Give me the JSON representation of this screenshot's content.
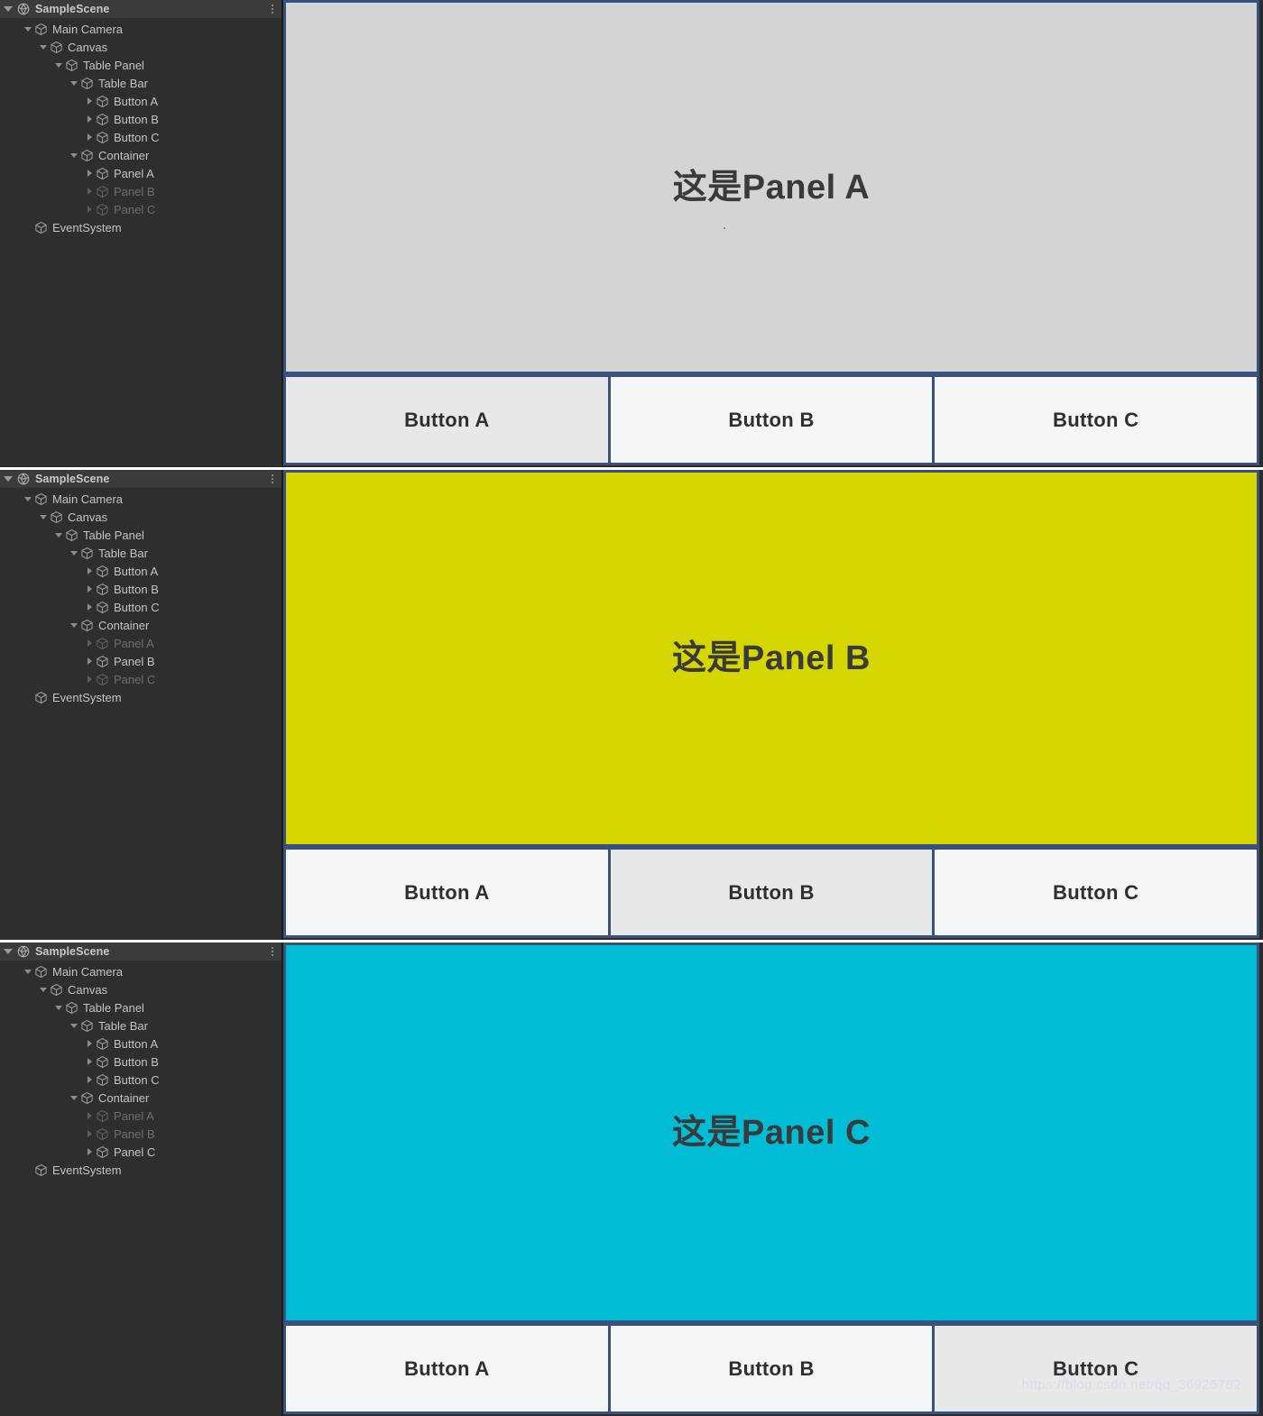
{
  "app": {
    "editor": "Unity Editor",
    "watermark": "https://blog.csdn.net/qq_36926782"
  },
  "colors": {
    "panel_a": "#d4d4d4",
    "panel_b": "#d6d600",
    "panel_c": "#00bcd4",
    "panel_border": "#3a5180",
    "tab_idle": "#f6f6f6",
    "tab_active": "#e8e8e8",
    "hierarchy_bg": "#2e2e2e",
    "hierarchy_header_bg": "#3b3b3b",
    "text_normal": "#c4c4c4",
    "text_dim": "#6e6e6e"
  },
  "sections": [
    {
      "hierarchy": {
        "scene_name": "SampleScene",
        "scene_icon": "unity-scene-icon",
        "menu_icon": "kebab-menu-icon",
        "collapse_icon": "triangle-down-icon",
        "nodes": [
          {
            "label": "Main Camera",
            "indent": 1,
            "arrow": "down",
            "dim": false
          },
          {
            "label": "Canvas",
            "indent": 2,
            "arrow": "down",
            "dim": false
          },
          {
            "label": "Table Panel",
            "indent": 3,
            "arrow": "down",
            "dim": false
          },
          {
            "label": "Table Bar",
            "indent": 4,
            "arrow": "down",
            "dim": false
          },
          {
            "label": "Button A",
            "indent": 5,
            "arrow": "right",
            "dim": false
          },
          {
            "label": "Button B",
            "indent": 5,
            "arrow": "right",
            "dim": false
          },
          {
            "label": "Button C",
            "indent": 5,
            "arrow": "right",
            "dim": false
          },
          {
            "label": "Container",
            "indent": 4,
            "arrow": "down",
            "dim": false
          },
          {
            "label": "Panel A",
            "indent": 5,
            "arrow": "right",
            "dim": false
          },
          {
            "label": "Panel B",
            "indent": 5,
            "arrow": "right",
            "dim": true
          },
          {
            "label": "Panel C",
            "indent": 5,
            "arrow": "right",
            "dim": true
          },
          {
            "label": "EventSystem",
            "indent": 1,
            "arrow": "none",
            "dim": false
          }
        ]
      },
      "game": {
        "panel_text": "这是Panel A",
        "panel_color": "#d4d4d4",
        "show_dot": true,
        "tabs": [
          {
            "label": "Button A",
            "active": true
          },
          {
            "label": "Button B",
            "active": false
          },
          {
            "label": "Button C",
            "active": false
          }
        ]
      }
    },
    {
      "hierarchy": {
        "scene_name": "SampleScene",
        "scene_icon": "unity-scene-icon",
        "menu_icon": "kebab-menu-icon",
        "collapse_icon": "triangle-down-icon",
        "nodes": [
          {
            "label": "Main Camera",
            "indent": 1,
            "arrow": "down",
            "dim": false
          },
          {
            "label": "Canvas",
            "indent": 2,
            "arrow": "down",
            "dim": false
          },
          {
            "label": "Table Panel",
            "indent": 3,
            "arrow": "down",
            "dim": false
          },
          {
            "label": "Table Bar",
            "indent": 4,
            "arrow": "down",
            "dim": false
          },
          {
            "label": "Button A",
            "indent": 5,
            "arrow": "right",
            "dim": false
          },
          {
            "label": "Button B",
            "indent": 5,
            "arrow": "right",
            "dim": false
          },
          {
            "label": "Button C",
            "indent": 5,
            "arrow": "right",
            "dim": false
          },
          {
            "label": "Container",
            "indent": 4,
            "arrow": "down",
            "dim": false
          },
          {
            "label": "Panel A",
            "indent": 5,
            "arrow": "right",
            "dim": true
          },
          {
            "label": "Panel B",
            "indent": 5,
            "arrow": "right",
            "dim": false
          },
          {
            "label": "Panel C",
            "indent": 5,
            "arrow": "right",
            "dim": true
          },
          {
            "label": "EventSystem",
            "indent": 1,
            "arrow": "none",
            "dim": false
          }
        ]
      },
      "game": {
        "panel_text": "这是Panel B",
        "panel_color": "#d6d600",
        "show_dot": false,
        "tabs": [
          {
            "label": "Button A",
            "active": false
          },
          {
            "label": "Button B",
            "active": true
          },
          {
            "label": "Button C",
            "active": false
          }
        ]
      }
    },
    {
      "hierarchy": {
        "scene_name": "SampleScene",
        "scene_icon": "unity-scene-icon",
        "menu_icon": "kebab-menu-icon",
        "collapse_icon": "triangle-down-icon",
        "nodes": [
          {
            "label": "Main Camera",
            "indent": 1,
            "arrow": "down",
            "dim": false
          },
          {
            "label": "Canvas",
            "indent": 2,
            "arrow": "down",
            "dim": false
          },
          {
            "label": "Table Panel",
            "indent": 3,
            "arrow": "down",
            "dim": false
          },
          {
            "label": "Table Bar",
            "indent": 4,
            "arrow": "down",
            "dim": false
          },
          {
            "label": "Button A",
            "indent": 5,
            "arrow": "right",
            "dim": false
          },
          {
            "label": "Button B",
            "indent": 5,
            "arrow": "right",
            "dim": false
          },
          {
            "label": "Button C",
            "indent": 5,
            "arrow": "right",
            "dim": false
          },
          {
            "label": "Container",
            "indent": 4,
            "arrow": "down",
            "dim": false
          },
          {
            "label": "Panel A",
            "indent": 5,
            "arrow": "right",
            "dim": true
          },
          {
            "label": "Panel B",
            "indent": 5,
            "arrow": "right",
            "dim": true
          },
          {
            "label": "Panel C",
            "indent": 5,
            "arrow": "right",
            "dim": false
          },
          {
            "label": "EventSystem",
            "indent": 1,
            "arrow": "none",
            "dim": false
          }
        ]
      },
      "game": {
        "panel_text": "这是Panel C",
        "panel_color": "#00bcd4",
        "show_dot": false,
        "tabs": [
          {
            "label": "Button A",
            "active": false
          },
          {
            "label": "Button B",
            "active": false
          },
          {
            "label": "Button C",
            "active": true
          }
        ]
      }
    }
  ]
}
